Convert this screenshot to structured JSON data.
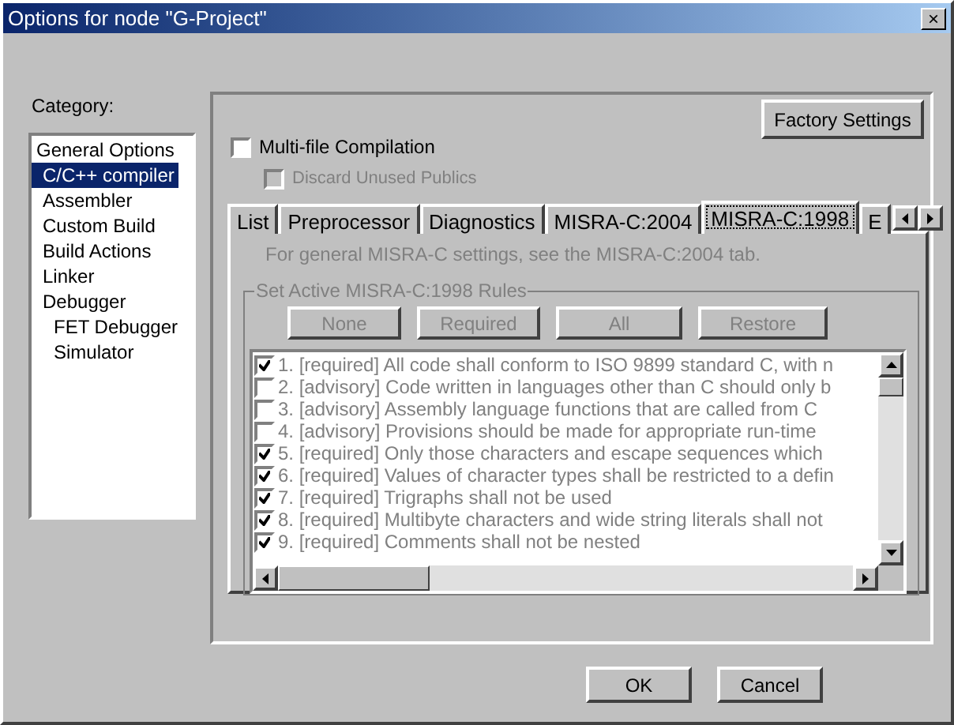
{
  "window": {
    "title": "Options for node \"G-Project\"",
    "close": "×"
  },
  "category": {
    "label": "Category:",
    "items": [
      {
        "label": "General Options",
        "selected": false
      },
      {
        "label": "C/C++ compiler",
        "selected": true
      },
      {
        "label": "Assembler",
        "selected": false
      },
      {
        "label": "Custom Build",
        "selected": false
      },
      {
        "label": "Build Actions",
        "selected": false
      },
      {
        "label": "Linker",
        "selected": false
      },
      {
        "label": "Debugger",
        "selected": false,
        "children": [
          {
            "label": "FET Debugger",
            "selected": false
          },
          {
            "label": "Simulator",
            "selected": false
          }
        ]
      }
    ]
  },
  "factory_button": "Factory Settings",
  "options": [
    {
      "label": "Multi-file Compilation",
      "checked": false,
      "disabled": false
    },
    {
      "label": "Discard Unused Publics",
      "checked": false,
      "disabled": true
    }
  ],
  "tabs": [
    {
      "label": "List",
      "selected": false
    },
    {
      "label": "Preprocessor",
      "selected": false
    },
    {
      "label": "Diagnostics",
      "selected": false
    },
    {
      "label": "MISRA-C:2004",
      "selected": false
    },
    {
      "label": "MISRA-C:1998",
      "selected": true
    },
    {
      "label": "E",
      "selected": false
    }
  ],
  "info": "For general MISRA-C settings, see the MISRA-C:2004 tab.",
  "group": {
    "title": "Set Active MISRA-C:1998 Rules",
    "buttons": [
      {
        "label": "None",
        "disabled": true
      },
      {
        "label": "Required",
        "disabled": true
      },
      {
        "label": "All",
        "disabled": true
      },
      {
        "label": "Restore",
        "disabled": true
      }
    ],
    "rules": [
      {
        "number": "1.",
        "level": "[required]",
        "text": "All code shall conform to ISO 9899 standard C, with n",
        "checked": true
      },
      {
        "number": "2.",
        "level": "[advisory]",
        "text": "Code written in languages other than C should only b",
        "checked": false
      },
      {
        "number": "3.",
        "level": "[advisory]",
        "text": "Assembly language functions that are called from C",
        "checked": false
      },
      {
        "number": "4.",
        "level": "[advisory]",
        "text": "Provisions should be made for appropriate run-time",
        "checked": false
      },
      {
        "number": "5.",
        "level": "[required]",
        "text": "Only those characters and escape sequences which",
        "checked": true
      },
      {
        "number": "6.",
        "level": "[required]",
        "text": "Values of character types shall be restricted to a defin",
        "checked": true
      },
      {
        "number": "7.",
        "level": "[required]",
        "text": "Trigraphs shall not be used",
        "checked": true
      },
      {
        "number": "8.",
        "level": "[required]",
        "text": "Multibyte characters and wide string literals shall not",
        "checked": true
      },
      {
        "number": "9.",
        "level": "[required]",
        "text": "Comments shall not be nested",
        "checked": true
      }
    ]
  },
  "dialog_buttons": [
    "OK",
    "Cancel"
  ]
}
